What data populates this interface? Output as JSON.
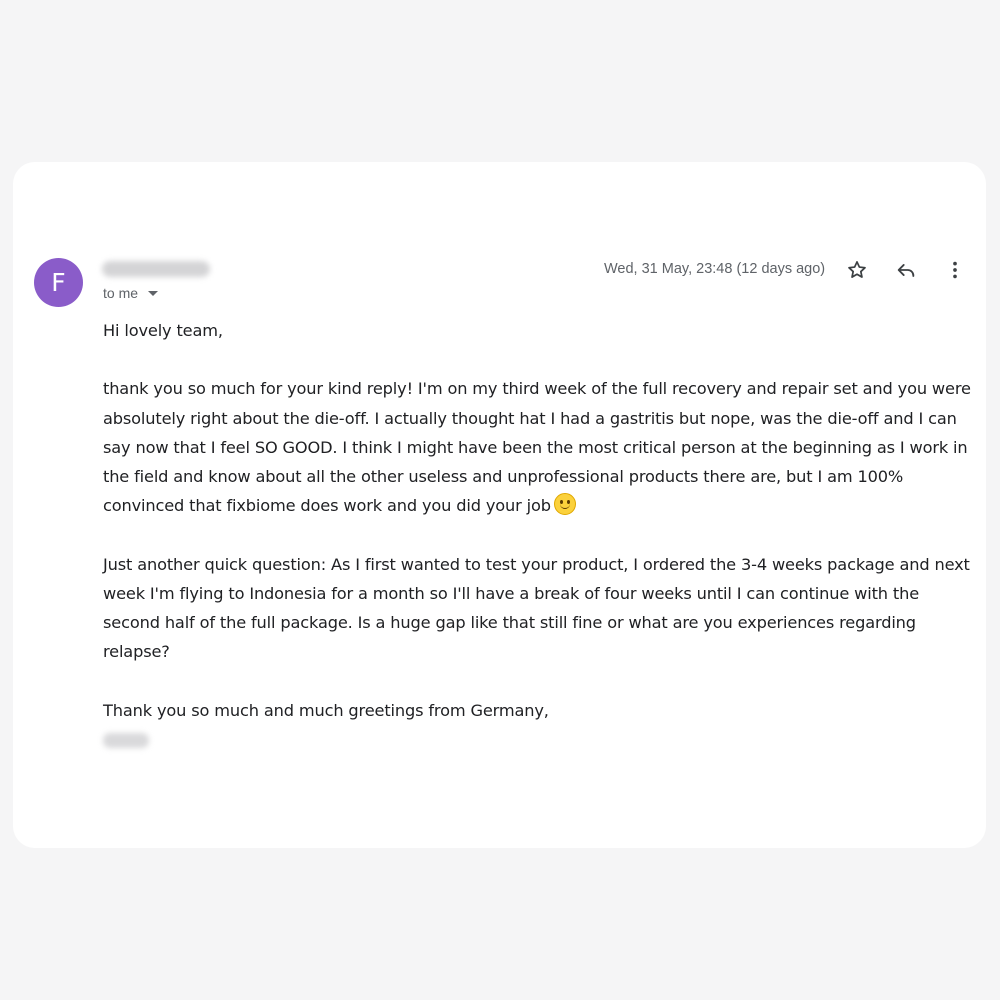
{
  "header": {
    "avatar_letter": "F",
    "recipient_label": "to me",
    "date": "Wed, 31 May, 23:48 (12 days ago)"
  },
  "icons": {
    "star": "star-icon",
    "reply": "reply-icon",
    "more": "more-vert-icon",
    "recipients_toggle": "chevron-down-icon"
  },
  "colors": {
    "avatar_bg": "#8a5cc9",
    "page_bg": "#f5f5f6",
    "card_bg": "#ffffff",
    "meta_text": "#5f6368",
    "body_text": "#202124"
  },
  "body": {
    "greeting": "Hi lovely team,",
    "para1": [
      "thank you so much for your kind reply! I'm on my third week of the full recovery and repair set and you were",
      "absolutely right about the die-off. I actually thought hat I had a gastritis but nope, was the die-off and I can",
      "say now that I feel SO GOOD. I think I might have been the most critical person at the beginning as I work in",
      "the field and know about all the other useless and unprofessional products there are, but I am 100%",
      "convinced that fixbiome does work and you did your job"
    ],
    "para2": [
      "Just another quick question: As I first wanted to test your product, I ordered the 3-4 weeks package and next",
      "week I'm flying to Indonesia for a month so I'll have a break of four weeks until I can continue with the",
      "second half of the full package. Is a huge gap like that still fine or what are you experiences regarding",
      "relapse?"
    ],
    "closing": "Thank you so much and much greetings from Germany,"
  }
}
